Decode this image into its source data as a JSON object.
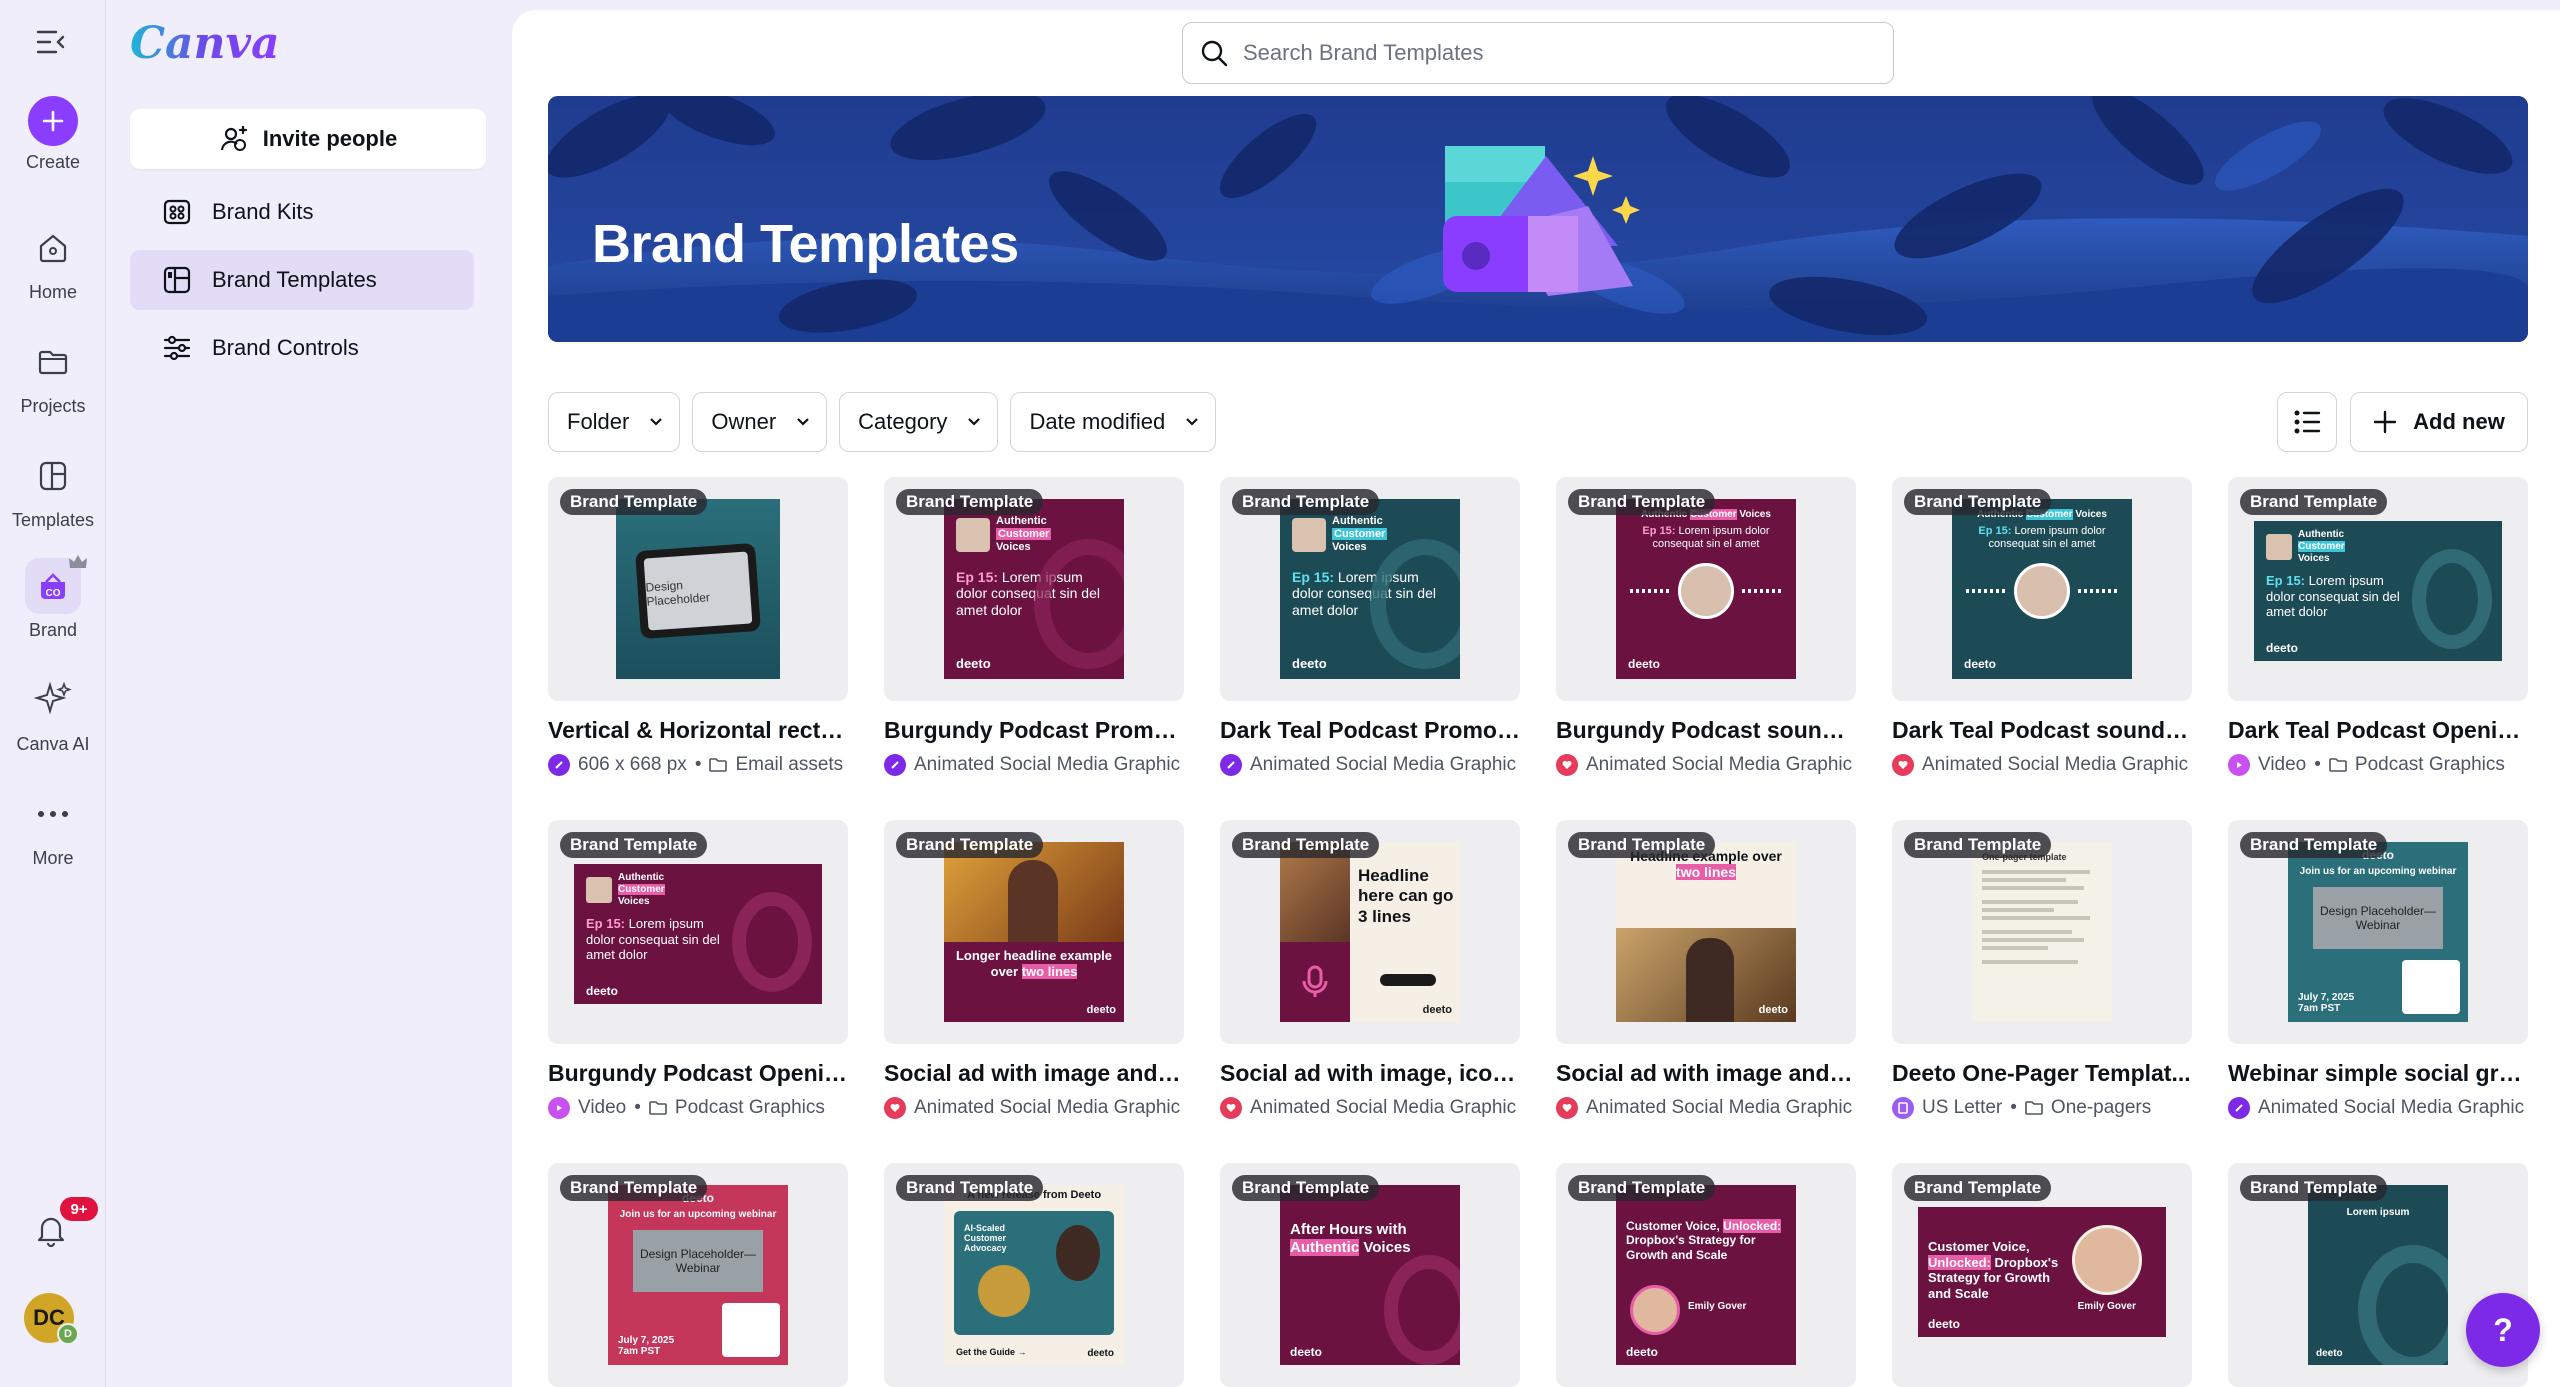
{
  "rail": {
    "create": "Create",
    "home": "Home",
    "projects": "Projects",
    "templates": "Templates",
    "brand": "Brand",
    "canva_ai": "Canva AI",
    "more": "More",
    "notifications_badge": "9+",
    "avatar_initials": "DC",
    "avatar_sub": "D"
  },
  "panel": {
    "logo": "Canva",
    "invite": "Invite people",
    "items": [
      {
        "label": "Brand Kits"
      },
      {
        "label": "Brand Templates"
      },
      {
        "label": "Brand Controls"
      }
    ]
  },
  "search": {
    "placeholder": "Search Brand Templates"
  },
  "hero": {
    "title": "Brand Templates"
  },
  "filters": {
    "folder": "Folder",
    "owner": "Owner",
    "category": "Category",
    "date": "Date modified",
    "add_new": "Add new"
  },
  "tag": "Brand Template",
  "cards": [
    {
      "name": "Vertical & Horizontal recta...",
      "meta": "606 x 668 px",
      "meta2": "Email assets",
      "icon": "design"
    },
    {
      "name": "Burgundy Podcast Promo ...",
      "meta": "Animated Social Media Graphic",
      "icon": "design"
    },
    {
      "name": "Dark Teal Podcast Promo ...",
      "meta": "Animated Social Media Graphic",
      "icon": "design"
    },
    {
      "name": "Burgundy Podcast sound ...",
      "meta": "Animated Social Media Graphic",
      "icon": "social"
    },
    {
      "name": "Dark Teal Podcast sound c...",
      "meta": "Animated Social Media Graphic",
      "icon": "social"
    },
    {
      "name": "Dark Teal Podcast Openin...",
      "meta": "Video",
      "meta2": "Podcast Graphics",
      "icon": "video"
    },
    {
      "name": "Burgundy Podcast Openin...",
      "meta": "Video",
      "meta2": "Podcast Graphics",
      "icon": "video"
    },
    {
      "name": "Social ad with image and t...",
      "meta": "Animated Social Media Graphic",
      "icon": "social"
    },
    {
      "name": "Social ad with image, icon,...",
      "meta": "Animated Social Media Graphic",
      "icon": "social"
    },
    {
      "name": "Social ad with image and t...",
      "meta": "Animated Social Media Graphic",
      "icon": "social"
    },
    {
      "name": "Deeto One-Pager Templat...",
      "meta": "US Letter",
      "meta2": "One-pagers",
      "icon": "doc"
    },
    {
      "name": "Webinar simple social gra...",
      "meta": "Animated Social Media Graphic",
      "icon": "design"
    }
  ],
  "art": {
    "design_placeholder": "Design Placeholder",
    "authentic": "Authentic",
    "customer": "Customer",
    "voices": "Voices",
    "ep15": "Ep 15:",
    "ep15_text": "Lorem ipsum dolor consequat sin del amet dolor",
    "ep15_short": "Lorem ipsum dolor consequat sin el amet",
    "deeto": "deeto",
    "longer_headline": "Longer headline example over",
    "two_lines": "two lines",
    "headline_3": "Headline here can go 3 lines",
    "headline_example": "Headline example over",
    "one_pager": "One-pager template",
    "join_webinar": "Join us for an upcoming webinar",
    "dp_webinar": "Design Placeholder— Webinar",
    "date": "July 7, 2025",
    "time": "7am PST",
    "new_release": "A new release from Deeto",
    "ai_scaled": "AI-Scaled Customer Advocacy",
    "get_guide": "Get the Guide →",
    "after_hours": "After Hours with",
    "authentic2": "Authentic",
    "voices2": "Voices",
    "customer_voice": "Customer Voice,",
    "unlocked": "Unlocked:",
    "dropbox_strategy": "Dropbox's Strategy for Growth and Scale",
    "emily": "Emily Gover",
    "lorem_ipsum": "Lorem ipsum"
  },
  "help": "?"
}
